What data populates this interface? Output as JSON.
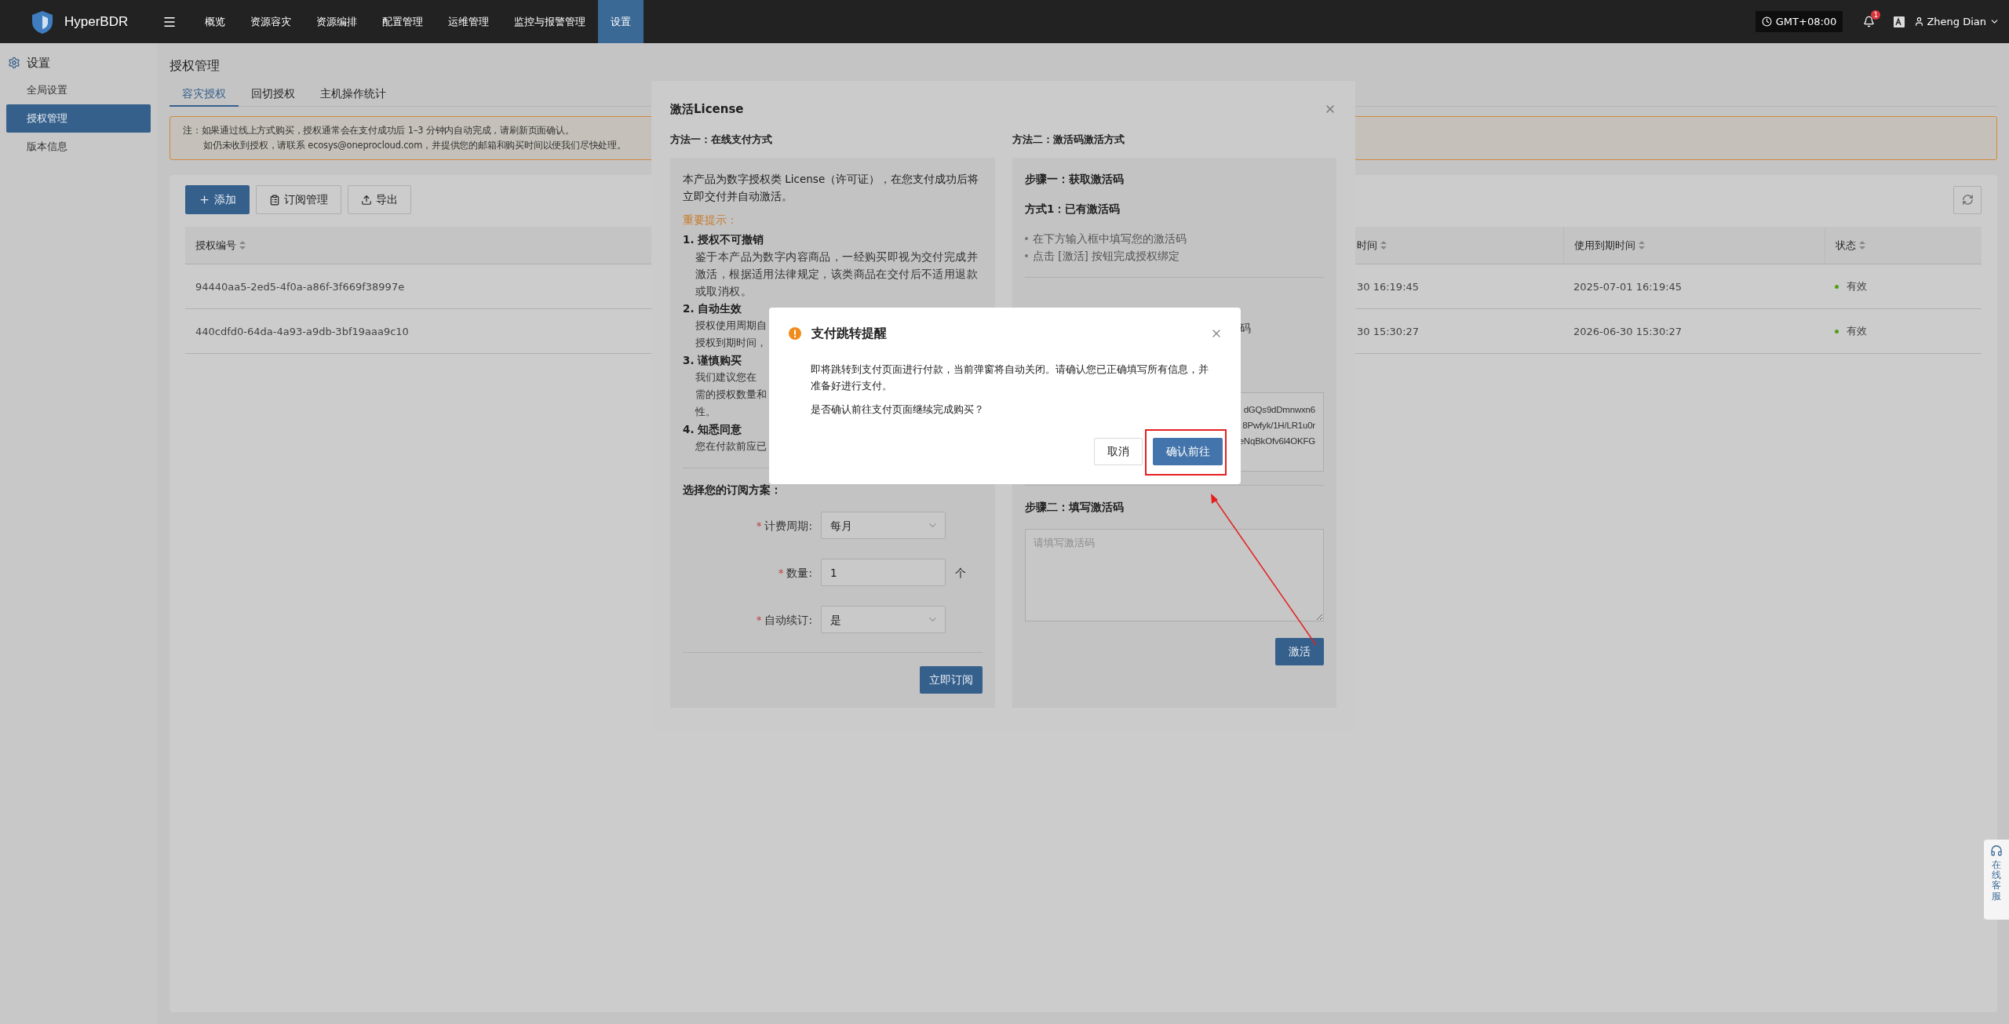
{
  "top_bar": {
    "brand": "HyperBDR",
    "nav": [
      {
        "label": "概览",
        "selected": false
      },
      {
        "label": "资源容灾",
        "selected": false
      },
      {
        "label": "资源编排",
        "selected": false
      },
      {
        "label": "配置管理",
        "selected": false
      },
      {
        "label": "运维管理",
        "selected": false
      },
      {
        "label": "监控与报警管理",
        "selected": false
      },
      {
        "label": "设置",
        "selected": true
      }
    ],
    "timezone": "GMT+08:00",
    "notification_count": "1",
    "user": "Zheng Dian"
  },
  "sidebar": {
    "title": "设置",
    "items": [
      {
        "label": "全局设置",
        "selected": false
      },
      {
        "label": "授权管理",
        "selected": true
      },
      {
        "label": "版本信息",
        "selected": false
      }
    ]
  },
  "page": {
    "title": "授权管理",
    "tabs": [
      {
        "label": "容灾授权",
        "selected": true
      },
      {
        "label": "回切授权",
        "selected": false
      },
      {
        "label": "主机操作统计",
        "selected": false
      }
    ],
    "notice": [
      "注：如果通过线上方式购买，授权通常会在支付成功后 1–3 分钟内自动完成，请刷新页面确认。",
      "如仍未收到授权，请联系 ecosys@oneprocloud.com，并提供您的邮箱和购买时间以便我们尽快处理。"
    ],
    "toolbar": [
      {
        "label": "添加",
        "kind": "primary"
      },
      {
        "label": "订阅管理",
        "kind": "default"
      },
      {
        "label": "导出",
        "kind": "default"
      }
    ],
    "table": {
      "columns": [
        "授权编号",
        "时间",
        "使用到期时间",
        "状态"
      ],
      "rows": [
        {
          "cells": [
            "94440aa5-2ed5-4f0a-a86f-3f669f38997e",
            "30 16:19:45",
            "2025-07-01 16:19:45",
            "有效"
          ]
        },
        {
          "cells": [
            "440cdfd0-64da-4a93-a9db-3bf19aaa9c10",
            "30 15:30:27",
            "2026-06-30 15:30:27",
            "有效"
          ]
        }
      ]
    }
  },
  "license_modal": {
    "title": "激活License",
    "online": {
      "heading": "方法一：在线支付方式",
      "intro": "本产品为数字授权类 License（许可证），在您支付成功后将立即交付并自动激活。",
      "notice_title": "重要提示：",
      "terms": [
        {
          "title": "1. 授权不可撤销",
          "text": "鉴于本产品为数字内容商品，一经购买即视为交付完成并激活，根据适用法律规定，该类商品在交付后不适用退款或取消权。"
        },
        {
          "title": "2. 自动生效",
          "lines": [
            "授权使用周期自",
            "授权到期时间，"
          ]
        },
        {
          "title": "3. 谨慎购买",
          "lines": [
            "我们建议您在",
            "需的授权数量和",
            "性。"
          ]
        },
        {
          "title": "4. 知悉同意",
          "lines": [
            "您在付款前应已"
          ]
        }
      ],
      "plan_title": "选择您的订阅方案：",
      "fields": [
        {
          "kind": "select",
          "mark": "*",
          "label": "计费周期:",
          "value": "每月"
        },
        {
          "kind": "input",
          "mark": "*",
          "label": "数量:",
          "value": "1",
          "unit": "个"
        },
        {
          "kind": "select",
          "mark": "*",
          "label": "自动续订:",
          "value": "是"
        }
      ],
      "submit": "立即订阅"
    },
    "code": {
      "heading": "方法二：激活码激活方式",
      "step1": "步骤一：获取激活码",
      "way1": "方式1：已有激活码",
      "bullets": [
        "在下方输入框中填写您的激活码",
        "点击 [激活] 按钮完成授权绑定"
      ],
      "fragment": "码",
      "code_lines": [
        "dGQs9dDmnwxn6",
        "8Pwfyk/1H/LR1u0r",
        "eNqBkOfv6l4OKFG"
      ],
      "step2": "步骤二：填写激活码",
      "placeholder": "请填写激活码",
      "activate": "激活"
    }
  },
  "confirm_dialog": {
    "title": "支付跳转提醒",
    "paragraphs": [
      "即将跳转到支付页面进行付款，当前弹窗将自动关闭。请确认您已正确填写所有信息，并准备好进行支付。",
      "是否确认前往支付页面继续完成购买？"
    ],
    "cancel": "取消",
    "confirm": "确认前往"
  },
  "support_tab": "在线客服"
}
